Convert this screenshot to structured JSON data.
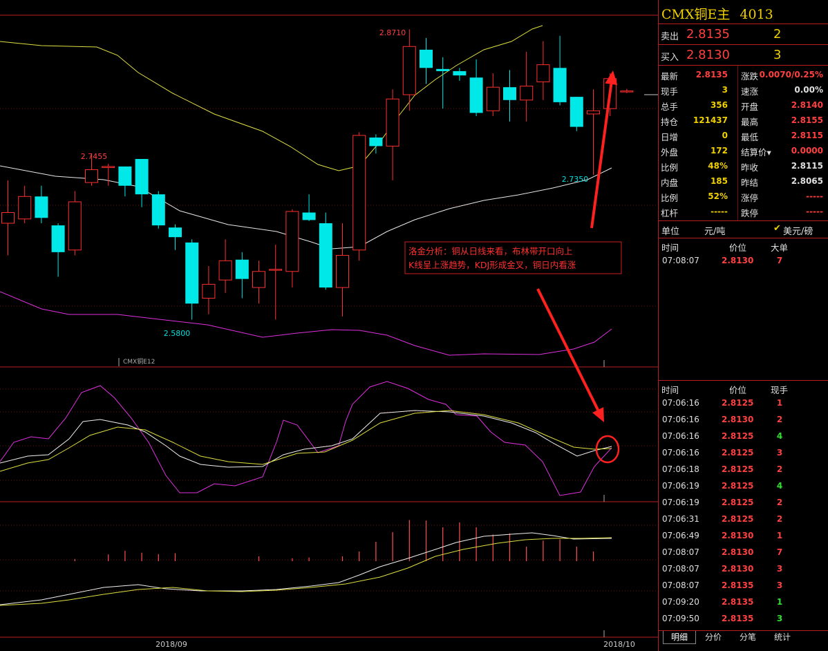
{
  "header": {
    "title": "CMX铜E主",
    "code": "4013"
  },
  "sell": {
    "label": "卖出",
    "price": "2.8135",
    "vol": "2"
  },
  "buy": {
    "label": "买入",
    "price": "2.8130",
    "vol": "3"
  },
  "quote": [
    {
      "k1": "最新",
      "v1": "2.8135",
      "c1": "#ff4040",
      "k2": "涨跌",
      "v2": "0.0070/0.25%",
      "c2": "#ff4040"
    },
    {
      "k1": "现手",
      "v1": "3",
      "c1": "#f0d000",
      "k2": "速涨",
      "v2": "0.00%",
      "c2": "#e0e0e0"
    },
    {
      "k1": "总手",
      "v1": "356",
      "c1": "#f0d000",
      "k2": "开盘",
      "v2": "2.8140",
      "c2": "#ff4040"
    },
    {
      "k1": "持仓",
      "v1": "121437",
      "c1": "#f0d000",
      "k2": "最高",
      "v2": "2.8155",
      "c2": "#ff4040"
    },
    {
      "k1": "日增",
      "v1": "0",
      "c1": "#f0d000",
      "k2": "最低",
      "v2": "2.8115",
      "c2": "#ff4040"
    },
    {
      "k1": "外盘",
      "v1": "172",
      "c1": "#f0d000",
      "k2": "结算价▾",
      "v2": "0.0000",
      "c2": "#ff4040"
    },
    {
      "k1": "比例",
      "v1": "48%",
      "c1": "#f0d000",
      "k2": "昨收",
      "v2": "2.8115",
      "c2": "#e0e0e0"
    },
    {
      "k1": "内盘",
      "v1": "185",
      "c1": "#f0d000",
      "k2": "昨结",
      "v2": "2.8065",
      "c2": "#e0e0e0"
    },
    {
      "k1": "比例",
      "v1": "52%",
      "c1": "#f0d000",
      "k2": "涨停",
      "v2": "-----",
      "c2": "#ff4040"
    },
    {
      "k1": "杠杆",
      "v1": "-----",
      "c1": "#f0d000",
      "k2": "跌停",
      "v2": "-----",
      "c2": "#ff4040"
    }
  ],
  "units": {
    "label": "单位",
    "unit": "元/吨",
    "check": "✔",
    "alt": "美元/磅"
  },
  "big_orders": {
    "headers": [
      "时间",
      "价位",
      "大单"
    ],
    "rows": [
      {
        "time": "07:08:07",
        "price": "2.8130",
        "vol": "7",
        "vcolor": "#ff4040"
      }
    ]
  },
  "ticks": {
    "headers": [
      "时间",
      "价位",
      "现手"
    ],
    "rows": [
      {
        "time": "07:06:16",
        "price": "2.8125",
        "vol": "1",
        "vcolor": "#ff4040"
      },
      {
        "time": "07:06:16",
        "price": "2.8130",
        "vol": "2",
        "vcolor": "#ff4040"
      },
      {
        "time": "07:06:16",
        "price": "2.8125",
        "vol": "4",
        "vcolor": "#30e030"
      },
      {
        "time": "07:06:16",
        "price": "2.8125",
        "vol": "3",
        "vcolor": "#ff4040"
      },
      {
        "time": "07:06:18",
        "price": "2.8125",
        "vol": "2",
        "vcolor": "#ff4040"
      },
      {
        "time": "07:06:19",
        "price": "2.8125",
        "vol": "4",
        "vcolor": "#30e030"
      },
      {
        "time": "07:06:19",
        "price": "2.8125",
        "vol": "2",
        "vcolor": "#ff4040"
      },
      {
        "time": "07:06:31",
        "price": "2.8125",
        "vol": "2",
        "vcolor": "#ff4040"
      },
      {
        "time": "07:06:49",
        "price": "2.8130",
        "vol": "1",
        "vcolor": "#ff4040"
      },
      {
        "time": "07:08:07",
        "price": "2.8130",
        "vol": "7",
        "vcolor": "#ff4040"
      },
      {
        "time": "07:08:07",
        "price": "2.8130",
        "vol": "3",
        "vcolor": "#ff4040"
      },
      {
        "time": "07:08:07",
        "price": "2.8135",
        "vol": "3",
        "vcolor": "#ff4040"
      },
      {
        "time": "07:09:20",
        "price": "2.8135",
        "vol": "1",
        "vcolor": "#30e030"
      },
      {
        "time": "07:09:50",
        "price": "2.8135",
        "vol": "3",
        "vcolor": "#30e030"
      }
    ]
  },
  "tabs": [
    "明细",
    "分价",
    "分笔",
    "统计"
  ],
  "chart_data": {
    "type": "candlestick",
    "instrument_label": "CMX铜E12",
    "x_labels": [
      "2018/09",
      "2018/10"
    ],
    "annotations": {
      "high": "2.8710",
      "high2": "2.7455",
      "low": "2.5800",
      "low2": "2.7350"
    },
    "comment_line1": "洛金分析：铜从日线来看，布林带开口向上",
    "comment_line2": "K线呈上涨趋势，KDJ形成金叉，铜日内看涨",
    "candles": [
      {
        "o": 2.69,
        "c": 2.7,
        "h": 2.73,
        "l": 2.66,
        "up": true
      },
      {
        "o": 2.694,
        "c": 2.715,
        "h": 2.725,
        "l": 2.69,
        "up": true
      },
      {
        "o": 2.715,
        "c": 2.695,
        "h": 2.725,
        "l": 2.69,
        "up": false
      },
      {
        "o": 2.688,
        "c": 2.663,
        "h": 2.69,
        "l": 2.64,
        "up": false
      },
      {
        "o": 2.665,
        "c": 2.71,
        "h": 2.72,
        "l": 2.66,
        "up": true
      },
      {
        "o": 2.728,
        "c": 2.74,
        "h": 2.755,
        "l": 2.725,
        "up": true
      },
      {
        "o": 2.742,
        "c": 2.743,
        "h": 2.7455,
        "l": 2.725,
        "up": true
      },
      {
        "o": 2.743,
        "c": 2.725,
        "h": 2.742,
        "l": 2.715,
        "up": false
      },
      {
        "o": 2.75,
        "c": 2.717,
        "h": 2.75,
        "l": 2.705,
        "up": false
      },
      {
        "o": 2.717,
        "c": 2.688,
        "h": 2.72,
        "l": 2.685,
        "up": false
      },
      {
        "o": 2.686,
        "c": 2.677,
        "h": 2.689,
        "l": 2.665,
        "up": false
      },
      {
        "o": 2.672,
        "c": 2.615,
        "h": 2.675,
        "l": 2.6,
        "up": false
      },
      {
        "o": 2.62,
        "c": 2.633,
        "h": 2.65,
        "l": 2.605,
        "up": true
      },
      {
        "o": 2.637,
        "c": 2.655,
        "h": 2.675,
        "l": 2.625,
        "up": true
      },
      {
        "o": 2.656,
        "c": 2.638,
        "h": 2.663,
        "l": 2.62,
        "up": false
      },
      {
        "o": 2.63,
        "c": 2.645,
        "h": 2.655,
        "l": 2.615,
        "up": true
      },
      {
        "o": 2.647,
        "c": 2.647,
        "h": 2.67,
        "l": 2.6,
        "up": true
      },
      {
        "o": 2.645,
        "c": 2.701,
        "h": 2.703,
        "l": 2.63,
        "up": true
      },
      {
        "o": 2.7,
        "c": 2.693,
        "h": 2.717,
        "l": 2.692,
        "up": false
      },
      {
        "o": 2.69,
        "c": 2.63,
        "h": 2.7,
        "l": 2.628,
        "up": false
      },
      {
        "o": 2.63,
        "c": 2.66,
        "h": 2.69,
        "l": 2.603,
        "up": true
      },
      {
        "o": 2.665,
        "c": 2.772,
        "h": 2.775,
        "l": 2.655,
        "up": true
      },
      {
        "o": 2.77,
        "c": 2.762,
        "h": 2.773,
        "l": 2.755,
        "up": false
      },
      {
        "o": 2.762,
        "c": 2.806,
        "h": 2.815,
        "l": 2.73,
        "up": true
      },
      {
        "o": 2.81,
        "c": 2.855,
        "h": 2.871,
        "l": 2.795,
        "up": true
      },
      {
        "o": 2.852,
        "c": 2.835,
        "h": 2.863,
        "l": 2.82,
        "up": false
      },
      {
        "o": 2.834,
        "c": 2.832,
        "h": 2.845,
        "l": 2.797,
        "up": false
      },
      {
        "o": 2.832,
        "c": 2.828,
        "h": 2.835,
        "l": 2.823,
        "up": false
      },
      {
        "o": 2.826,
        "c": 2.793,
        "h": 2.843,
        "l": 2.79,
        "up": false
      },
      {
        "o": 2.795,
        "c": 2.817,
        "h": 2.83,
        "l": 2.79,
        "up": true
      },
      {
        "o": 2.817,
        "c": 2.805,
        "h": 2.833,
        "l": 2.785,
        "up": false
      },
      {
        "o": 2.805,
        "c": 2.818,
        "h": 2.85,
        "l": 2.785,
        "up": true
      },
      {
        "o": 2.822,
        "c": 2.838,
        "h": 2.86,
        "l": 2.805,
        "up": true
      },
      {
        "o": 2.835,
        "c": 2.803,
        "h": 2.865,
        "l": 2.8,
        "up": false
      },
      {
        "o": 2.808,
        "c": 2.78,
        "h": 2.808,
        "l": 2.776,
        "up": false
      },
      {
        "o": 2.792,
        "c": 2.795,
        "h": 2.815,
        "l": 2.735,
        "up": true
      },
      {
        "o": 2.797,
        "c": 2.825,
        "h": 2.83,
        "l": 2.79,
        "up": true
      },
      {
        "o": 2.8135,
        "c": 2.8135,
        "h": 2.8155,
        "l": 2.8115,
        "up": true
      }
    ],
    "volumes": [
      0,
      0,
      0,
      0,
      9,
      0,
      28,
      43,
      35,
      29,
      33,
      0,
      0,
      0,
      0,
      20,
      0,
      12,
      15,
      0,
      20,
      40,
      80,
      120,
      170,
      168,
      140,
      160,
      140,
      110,
      115,
      60,
      85,
      90,
      60,
      40,
      0,
      0
    ]
  }
}
